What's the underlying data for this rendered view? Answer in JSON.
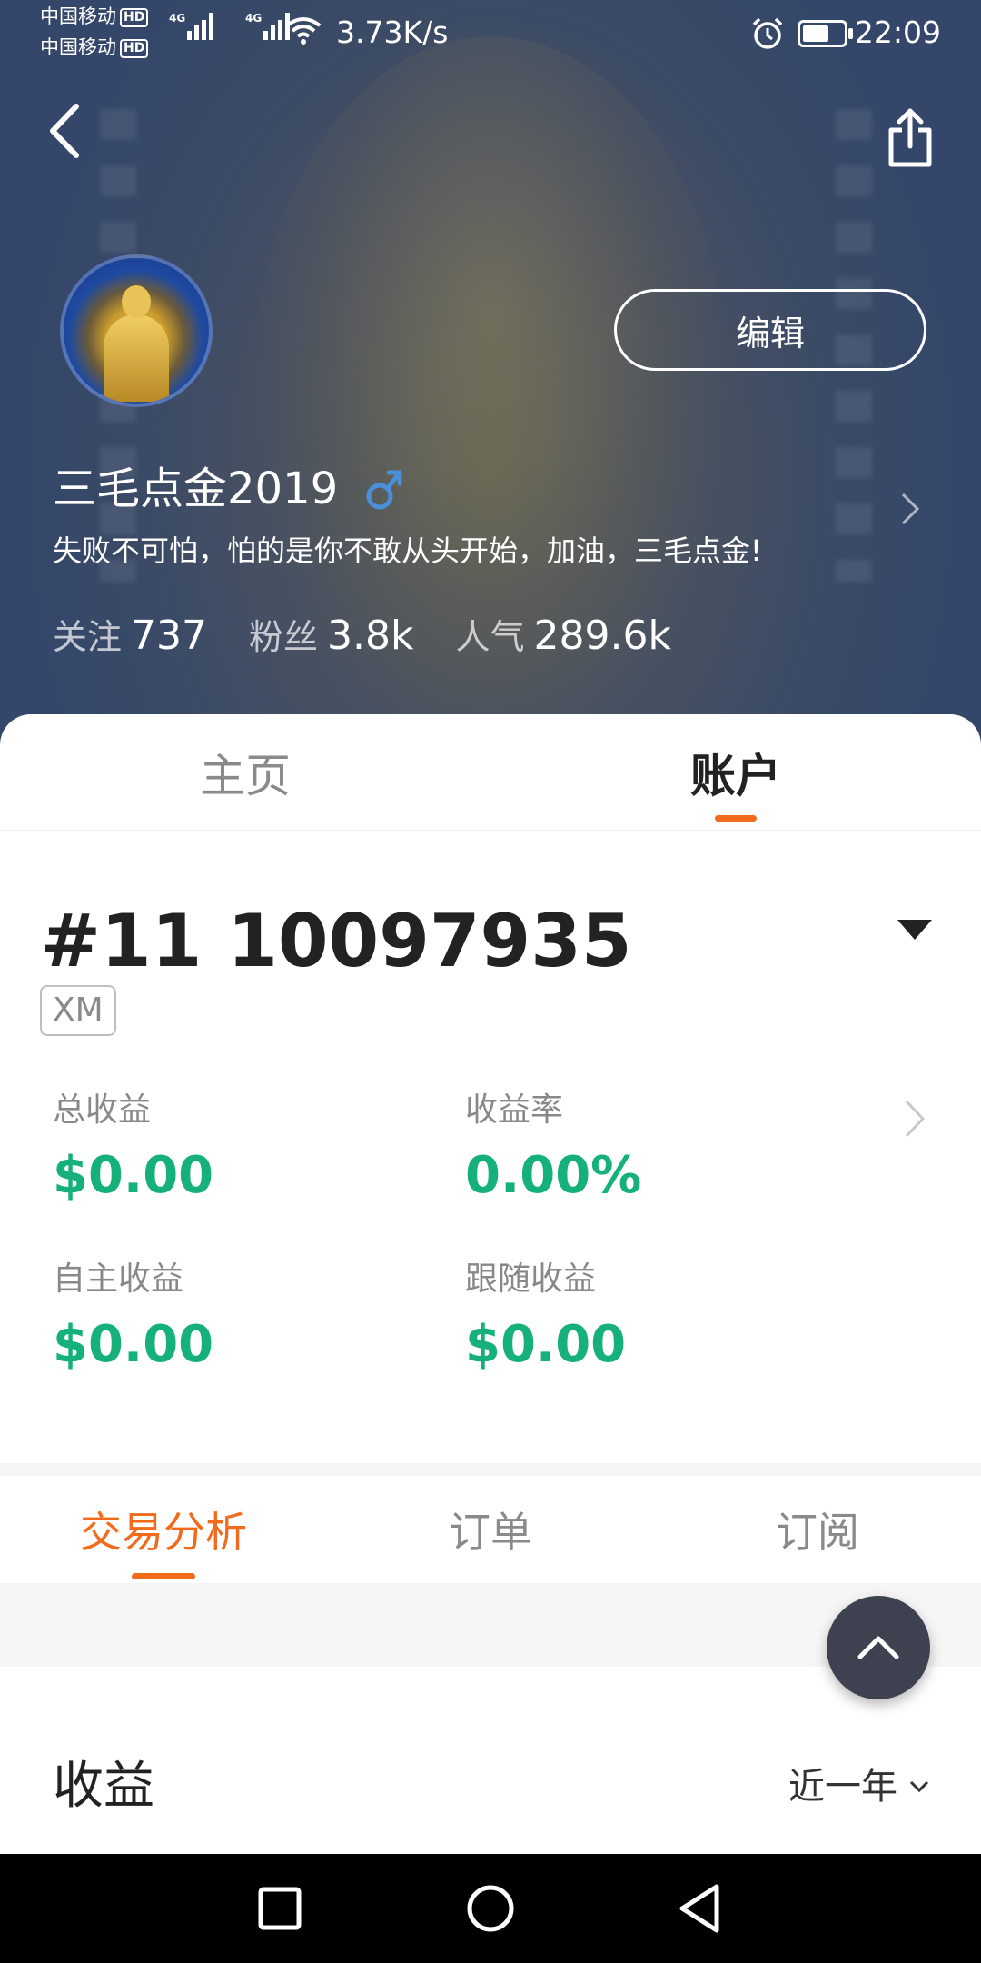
{
  "status_bar": {
    "carrier_1": "中国移动",
    "carrier_2": "中国移动",
    "hd_badge": "HD",
    "net_type": "4G",
    "net_speed": "3.73K/s",
    "time": "22:09",
    "icons": [
      "signal-icon",
      "wifi-icon",
      "alarm-icon",
      "battery-icon"
    ]
  },
  "profile": {
    "username": "三毛点金2019",
    "gender": "male",
    "bio": "失败不可怕，怕的是你不敢从头开始，加油，三毛点金!",
    "edit_label": "编辑",
    "stats": [
      {
        "label": "关注",
        "value": "737"
      },
      {
        "label": "粉丝",
        "value": "3.8k"
      },
      {
        "label": "人气",
        "value": "289.6k"
      }
    ]
  },
  "profile_tabs": [
    {
      "label": "主页",
      "active": false
    },
    {
      "label": "账户",
      "active": true
    }
  ],
  "account": {
    "number": "#11 10097935",
    "broker": "XM",
    "metrics": [
      {
        "label": "总收益",
        "value": "$0.00"
      },
      {
        "label": "收益率",
        "value": "0.00%"
      },
      {
        "label": "自主收益",
        "value": "$0.00"
      },
      {
        "label": "跟随收益",
        "value": "$0.00"
      }
    ]
  },
  "sub_tabs": [
    {
      "label": "交易分析",
      "active": true
    },
    {
      "label": "订单",
      "active": false
    },
    {
      "label": "订阅",
      "active": false
    }
  ],
  "earnings": {
    "title": "收益",
    "period": "近一年"
  },
  "colors": {
    "accent": "#f26b1d",
    "positive": "#16b07a",
    "header_bg": "#3a4a66",
    "gender_blue": "#4a90d9",
    "fab": "#3d4150"
  },
  "nav": {
    "icons": [
      "recent-apps-icon",
      "home-icon",
      "back-icon"
    ]
  }
}
